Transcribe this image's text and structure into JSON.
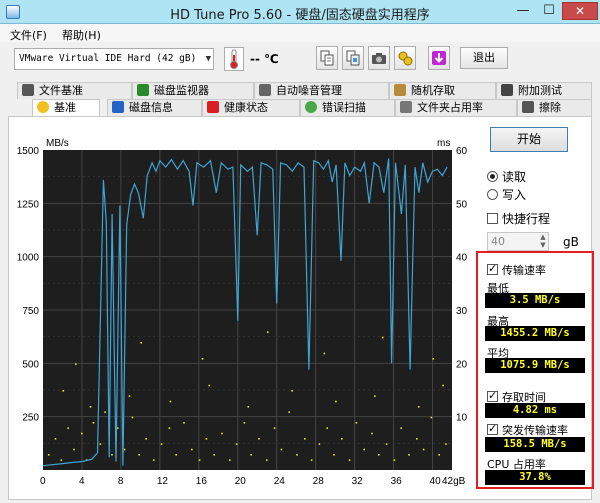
{
  "window": {
    "title": "HD Tune Pro 5.60 - 硬盘/固态硬盘实用程序",
    "min": "—",
    "max": "☐",
    "close": "✕"
  },
  "menu": [
    "文件(F)",
    "帮助(H)"
  ],
  "toolbar": {
    "drive": "VMware Virtual IDE Hard (42 gB)",
    "temperature": "-- ℃",
    "exit_label": "退出",
    "icons": [
      "copy-info-icon",
      "copy-screen-icon",
      "camera-icon",
      "options-icon",
      "save-icon"
    ]
  },
  "tabs_row1": [
    "文件基准",
    "磁盘监视器",
    "自动噪音管理",
    "随机存取",
    "附加测试"
  ],
  "tabs_row2": [
    "基准",
    "磁盘信息",
    "健康状态",
    "错误扫描",
    "文件夹占用率",
    "擦除"
  ],
  "active_tab": "基准",
  "side": {
    "start_label": "开始",
    "read_label": "读取",
    "write_label": "写入",
    "quick_label": "快捷行程",
    "size_value": "40",
    "size_unit": "gB",
    "transfer_label": "传输速率",
    "min_label": "最低",
    "min_value": "3.5 MB/s",
    "max_label": "最高",
    "max_value": "1455.2 MB/s",
    "avg_label": "平均",
    "avg_value": "1075.9 MB/s",
    "access_label": "存取时间",
    "access_value": "4.82 ms",
    "burst_label": "突发传输速率",
    "burst_value": "158.5 MB/s",
    "cpu_label": "CPU 占用率",
    "cpu_value": "37.8%"
  },
  "colors": {
    "transfer_line": "#3ea5d6",
    "access_points": "#e6e619",
    "plot_bg": "#1e1e1e",
    "grid": "#444444",
    "highlight": "#e02020"
  },
  "chart_data": {
    "type": "line",
    "yunit_left": "MB/s",
    "yunit_right": "ms",
    "xunit": "gB",
    "x_ticks": [
      "0",
      "4",
      "8",
      "12",
      "16",
      "20",
      "24",
      "28",
      "32",
      "36",
      "40",
      "42gB"
    ],
    "y_left_ticks": [
      "1500",
      "1250",
      "1000",
      "750",
      "500",
      "250"
    ],
    "y_right_ticks": [
      "60",
      "50",
      "40",
      "30",
      "20",
      "10"
    ],
    "xlim": [
      0,
      42
    ],
    "ylim_left": [
      0,
      1500
    ],
    "ylim_right": [
      0,
      60
    ],
    "grid": true,
    "series": [
      {
        "values": [
          [
            0,
            20
          ],
          [
            1,
            25
          ],
          [
            2,
            30
          ],
          [
            3,
            35
          ],
          [
            4,
            40
          ],
          [
            5,
            50
          ],
          [
            5.6,
            80
          ],
          [
            6.2,
            1360
          ],
          [
            6.5,
            1160
          ],
          [
            6.8,
            60
          ],
          [
            7.1,
            1200
          ],
          [
            7.5,
            40
          ],
          [
            7.9,
            1240
          ],
          [
            8.2,
            20
          ],
          [
            8.6,
            1150
          ],
          [
            9,
            1290
          ],
          [
            9.4,
            1340
          ],
          [
            9.8,
            1300
          ],
          [
            10.3,
            1180
          ],
          [
            10.7,
            1380
          ],
          [
            11.2,
            1440
          ],
          [
            11.6,
            1400
          ],
          [
            12,
            1450
          ],
          [
            12.6,
            1420
          ],
          [
            13.2,
            1455
          ],
          [
            13.8,
            1410
          ],
          [
            14.4,
            1450
          ],
          [
            15,
            1400
          ],
          [
            15.4,
            1240
          ],
          [
            15.8,
            1440
          ],
          [
            16.5,
            1420
          ],
          [
            17.2,
            1450
          ],
          [
            17.8,
            1300
          ],
          [
            18.3,
            1440
          ],
          [
            19,
            1410
          ],
          [
            19.5,
            1420
          ],
          [
            20,
            700
          ],
          [
            20.3,
            1430
          ],
          [
            21,
            1400
          ],
          [
            21.5,
            1420
          ],
          [
            22,
            1100
          ],
          [
            22.4,
            1440
          ],
          [
            23,
            1430
          ],
          [
            23.6,
            1410
          ],
          [
            24,
            780
          ],
          [
            24.4,
            1440
          ],
          [
            25,
            1430
          ],
          [
            25.6,
            1400
          ],
          [
            26.2,
            1440
          ],
          [
            26.8,
            1420
          ],
          [
            27.3,
            470
          ],
          [
            27.8,
            1450
          ],
          [
            28.3,
            1440
          ],
          [
            28.8,
            1410
          ],
          [
            29.3,
            1450
          ],
          [
            29.7,
            1350
          ],
          [
            30.1,
            1430
          ],
          [
            30.6,
            980
          ],
          [
            31,
            1440
          ],
          [
            31.5,
            1380
          ],
          [
            32,
            1420
          ],
          [
            32.6,
            1400
          ],
          [
            33,
            1440
          ],
          [
            33.5,
            1250
          ],
          [
            34,
            1440
          ],
          [
            34.5,
            1420
          ],
          [
            35,
            1300
          ],
          [
            35.5,
            1460
          ],
          [
            35.8,
            500
          ],
          [
            36.2,
            1440
          ],
          [
            36.8,
            1200
          ],
          [
            37.2,
            1430
          ],
          [
            37.7,
            470
          ],
          [
            38.2,
            1420
          ],
          [
            38.6,
            1300
          ],
          [
            39,
            1440
          ],
          [
            39.5,
            1350
          ],
          [
            40,
            1400
          ],
          [
            40.5,
            1410
          ],
          [
            41,
            1380
          ],
          [
            41.5,
            1420
          ]
        ]
      }
    ],
    "access_time_ms": [
      [
        0.5,
        3
      ],
      [
        1.2,
        6
      ],
      [
        1.8,
        2
      ],
      [
        2.5,
        8
      ],
      [
        3.1,
        4
      ],
      [
        3.9,
        7
      ],
      [
        4.4,
        2
      ],
      [
        5.1,
        9
      ],
      [
        5.8,
        5
      ],
      [
        6.3,
        11
      ],
      [
        7,
        3
      ],
      [
        7.6,
        8
      ],
      [
        8.3,
        4
      ],
      [
        9.1,
        10
      ],
      [
        9.8,
        3
      ],
      [
        10.5,
        6
      ],
      [
        11.3,
        2
      ],
      [
        12.1,
        5
      ],
      [
        12.9,
        8
      ],
      [
        13.6,
        3
      ],
      [
        14.4,
        9
      ],
      [
        15.2,
        4
      ],
      [
        16,
        2
      ],
      [
        16.7,
        6
      ],
      [
        17.5,
        3
      ],
      [
        18.3,
        7
      ],
      [
        19.1,
        2
      ],
      [
        19.8,
        5
      ],
      [
        20.6,
        9
      ],
      [
        21.3,
        3
      ],
      [
        22.1,
        6
      ],
      [
        22.9,
        2
      ],
      [
        23.7,
        8
      ],
      [
        24.4,
        4
      ],
      [
        25.2,
        11
      ],
      [
        26,
        3
      ],
      [
        26.8,
        6
      ],
      [
        27.5,
        2
      ],
      [
        28.3,
        5
      ],
      [
        29.1,
        8
      ],
      [
        29.8,
        3
      ],
      [
        30.6,
        6
      ],
      [
        31.4,
        2
      ],
      [
        32.1,
        9
      ],
      [
        32.9,
        4
      ],
      [
        33.7,
        7
      ],
      [
        34.4,
        3
      ],
      [
        35.2,
        5
      ],
      [
        36,
        2
      ],
      [
        36.7,
        8
      ],
      [
        37.5,
        3
      ],
      [
        38.3,
        6
      ],
      [
        39,
        4
      ],
      [
        39.8,
        10
      ],
      [
        40.6,
        3
      ],
      [
        41.3,
        5
      ],
      [
        2,
        15
      ],
      [
        4.8,
        12
      ],
      [
        8.8,
        14
      ],
      [
        13,
        13
      ],
      [
        17,
        16
      ],
      [
        21,
        12
      ],
      [
        25.5,
        15
      ],
      [
        30,
        13
      ],
      [
        34,
        14
      ],
      [
        38.5,
        12
      ],
      [
        41,
        16
      ],
      [
        3.3,
        20
      ],
      [
        10,
        24
      ],
      [
        16.3,
        21
      ],
      [
        23,
        26
      ],
      [
        28.8,
        22
      ],
      [
        34.8,
        25
      ],
      [
        40,
        21
      ]
    ]
  }
}
